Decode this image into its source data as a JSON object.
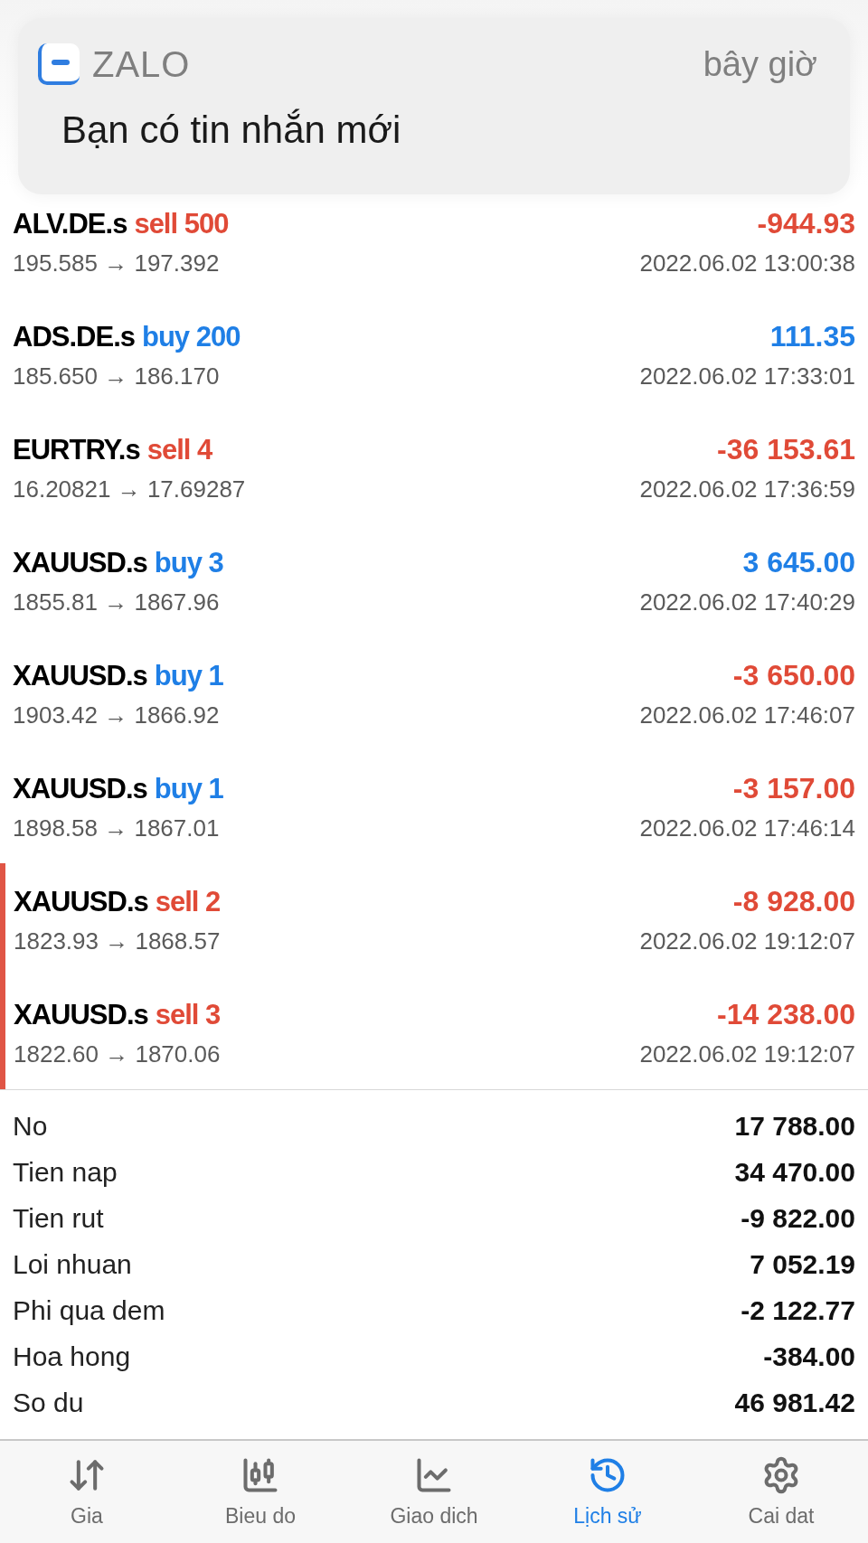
{
  "notification": {
    "app": "ZALO",
    "time": "bây giờ",
    "message": "Bạn có tin nhắn mới"
  },
  "trades": [
    {
      "symbol": "ALV.DE.s",
      "kind": "sell",
      "order": "sell 500",
      "color": "#e04a37",
      "profit": "-944.93",
      "prices": "195.585 → 197.392",
      "time": "2022.06.02 13:00:38",
      "highlighted": false
    },
    {
      "symbol": "ADS.DE.s",
      "kind": "buy",
      "order": "buy 200",
      "color": "#1f7fe6",
      "profit": "111.35",
      "prices": "185.650 → 186.170",
      "time": "2022.06.02 17:33:01",
      "highlighted": false
    },
    {
      "symbol": "EURTRY.s",
      "kind": "sell",
      "order": "sell 4",
      "color": "#e04a37",
      "profit": "-36 153.61",
      "prices": "16.20821 → 17.69287",
      "time": "2022.06.02 17:36:59",
      "highlighted": false
    },
    {
      "symbol": "XAUUSD.s",
      "kind": "buy",
      "order": "buy 3",
      "color": "#1f7fe6",
      "profit": "3 645.00",
      "prices": "1855.81 → 1867.96",
      "time": "2022.06.02 17:40:29",
      "highlighted": false
    },
    {
      "symbol": "XAUUSD.s",
      "kind": "buy",
      "order": "buy 1",
      "color": "#e04a37",
      "profit": "-3 650.00",
      "prices": "1903.42 → 1866.92",
      "time": "2022.06.02 17:46:07",
      "highlighted": false
    },
    {
      "symbol": "XAUUSD.s",
      "kind": "buy",
      "order": "buy 1",
      "color": "#e04a37",
      "profit": "-3 157.00",
      "prices": "1898.58 → 1867.01",
      "time": "2022.06.02 17:46:14",
      "highlighted": false
    },
    {
      "symbol": "XAUUSD.s",
      "kind": "sell",
      "order": "sell 2",
      "color": "#e04a37",
      "profit": "-8 928.00",
      "prices": "1823.93 → 1868.57",
      "time": "2022.06.02 19:12:07",
      "highlighted": true
    },
    {
      "symbol": "XAUUSD.s",
      "kind": "sell",
      "order": "sell 3",
      "color": "#e04a37",
      "profit": "-14 238.00",
      "prices": "1822.60 → 1870.06",
      "time": "2022.06.02 19:12:07",
      "highlighted": true
    }
  ],
  "summary": [
    {
      "label": "No",
      "value": "17 788.00"
    },
    {
      "label": "Tien nap",
      "value": "34 470.00"
    },
    {
      "label": "Tien rut",
      "value": "-9 822.00"
    },
    {
      "label": "Loi nhuan",
      "value": "7 052.19"
    },
    {
      "label": "Phi qua dem",
      "value": "-2 122.77"
    },
    {
      "label": "Hoa hong",
      "value": "-384.00"
    },
    {
      "label": "So du",
      "value": "46 981.42"
    }
  ],
  "tabs": [
    {
      "kind": "quotes",
      "label": "Gia",
      "selected": false
    },
    {
      "kind": "chart",
      "label": "Bieu do",
      "selected": false
    },
    {
      "kind": "trade",
      "label": "Giao dich",
      "selected": false
    },
    {
      "kind": "history",
      "label": "Lịch sử",
      "selected": true
    },
    {
      "kind": "settings",
      "label": "Cai dat",
      "selected": false
    }
  ]
}
